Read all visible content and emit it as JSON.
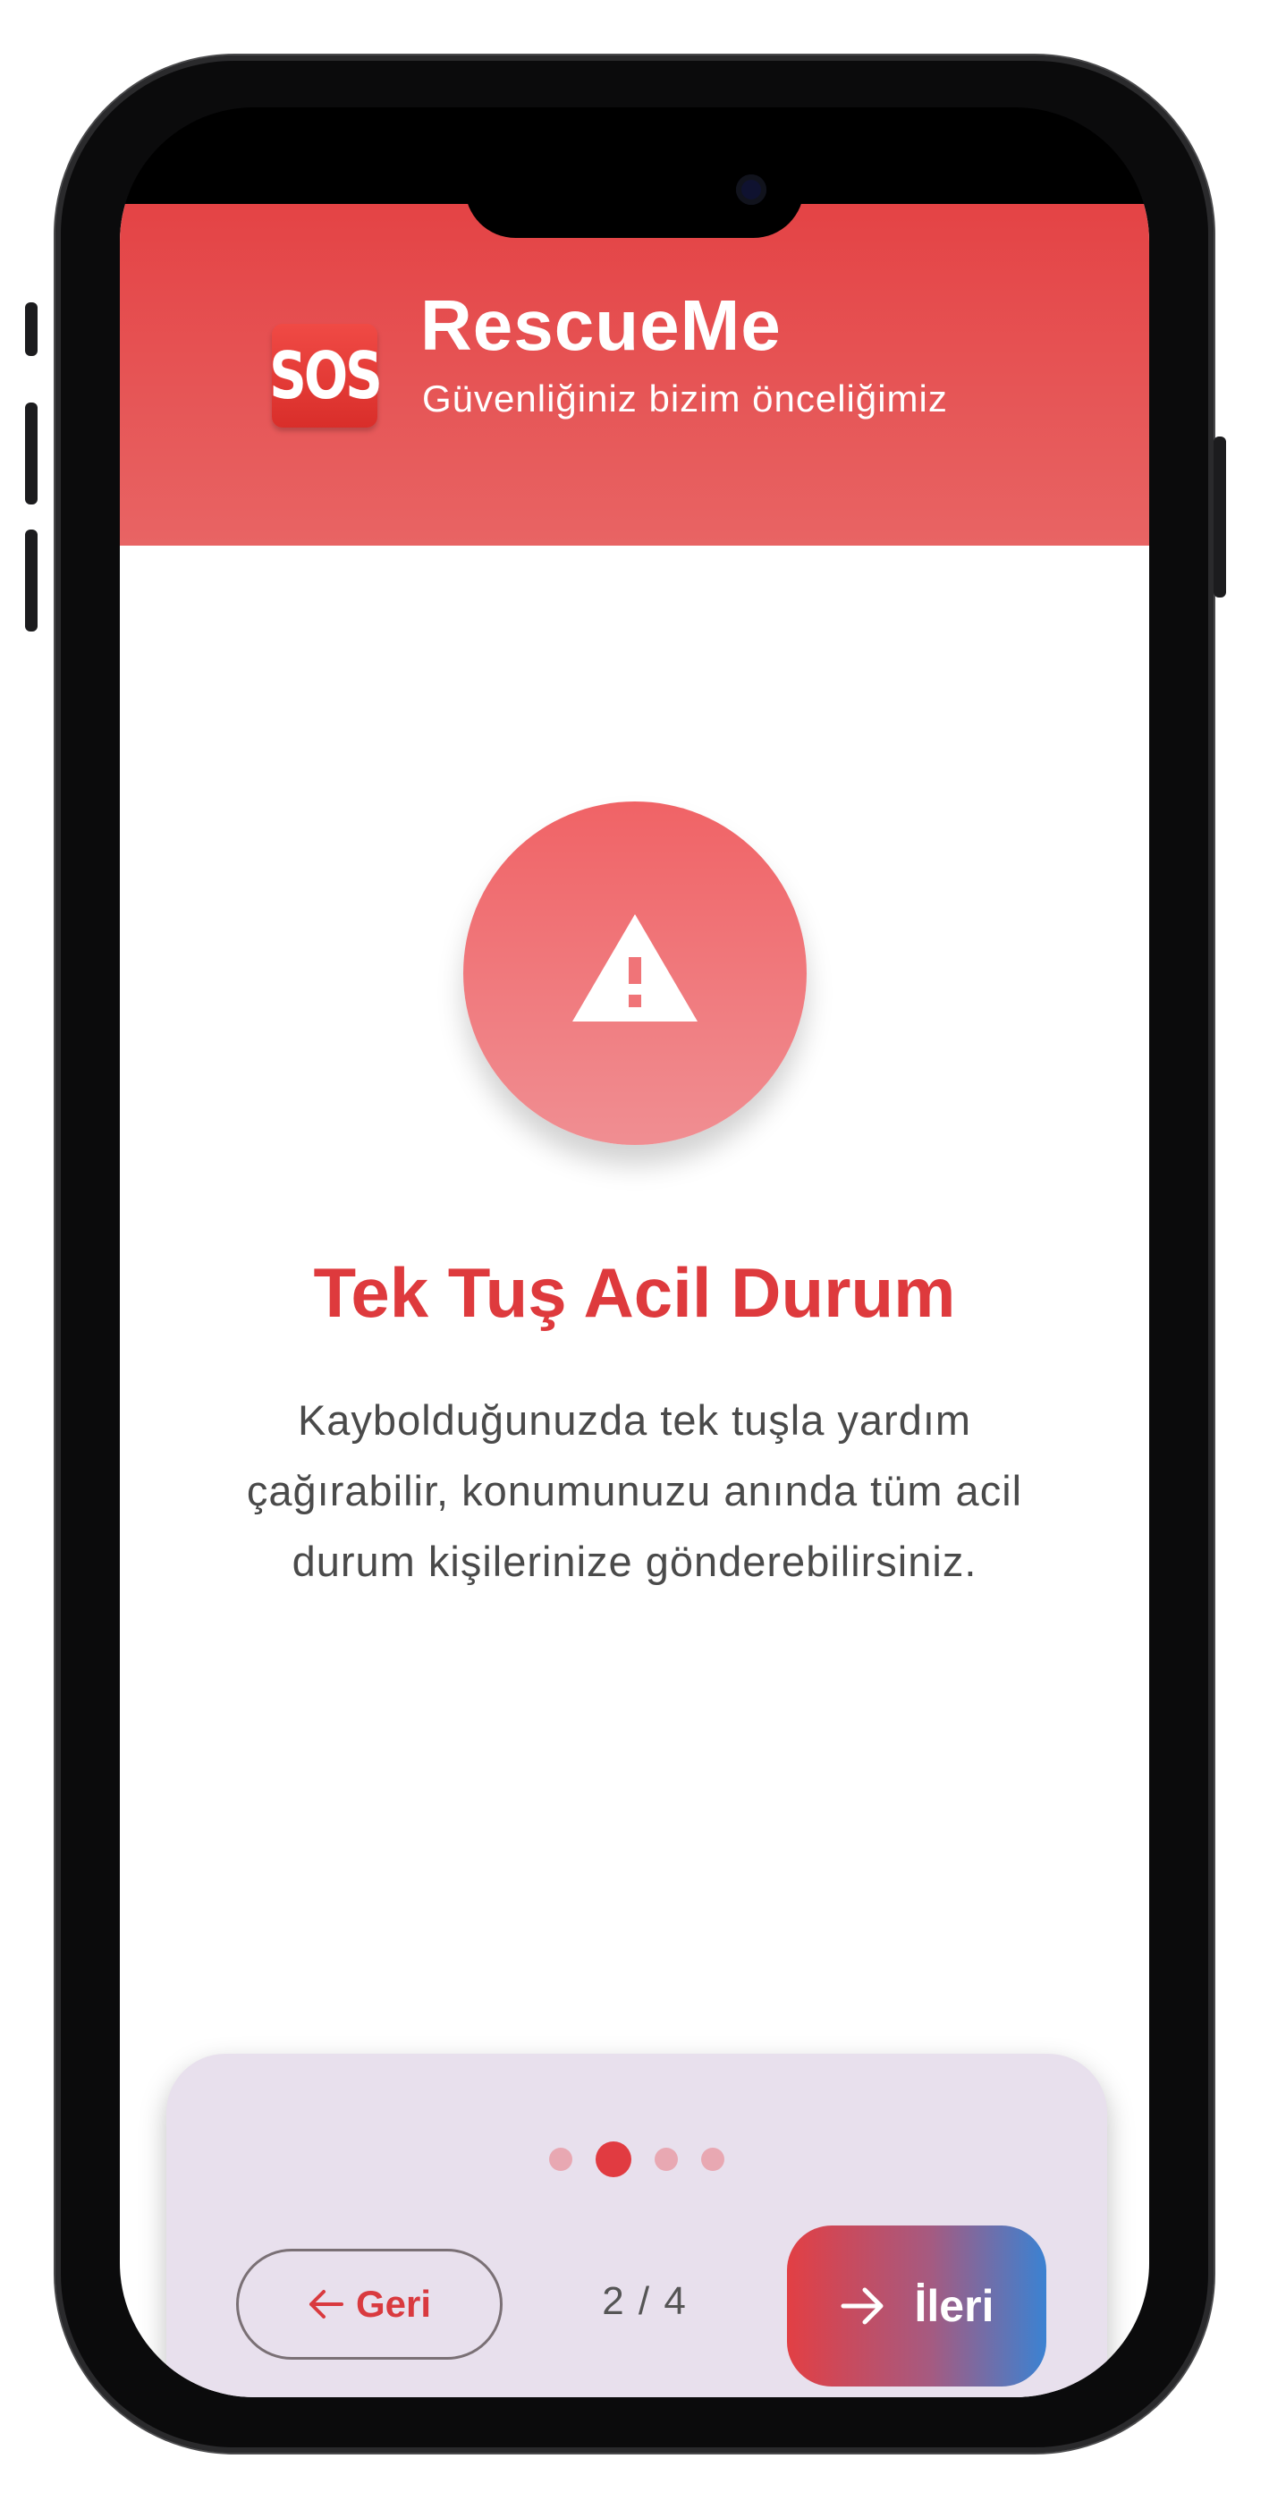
{
  "header": {
    "logo_text": "SOS",
    "app_name": "RescueMe",
    "tagline": "Güvenliğiniz bizim önceliğimiz"
  },
  "slide": {
    "icon": "warning-icon",
    "title": "Tek Tuş Acil Durum",
    "description": "Kaybolduğunuzda tek tuşla yardım çağırabilir, konumunuzu anında tüm acil durum kişilerinize gönderebilirsiniz."
  },
  "navigation": {
    "back_label": "Geri",
    "next_label": "İleri",
    "page_indicator": "2 / 4",
    "current_page": 2,
    "total_pages": 4
  },
  "colors": {
    "brand_red": "#e44345",
    "title_red": "#de3a3d",
    "next_gradient_end": "#3b82d2",
    "card_bg": "#e8e0ed"
  }
}
